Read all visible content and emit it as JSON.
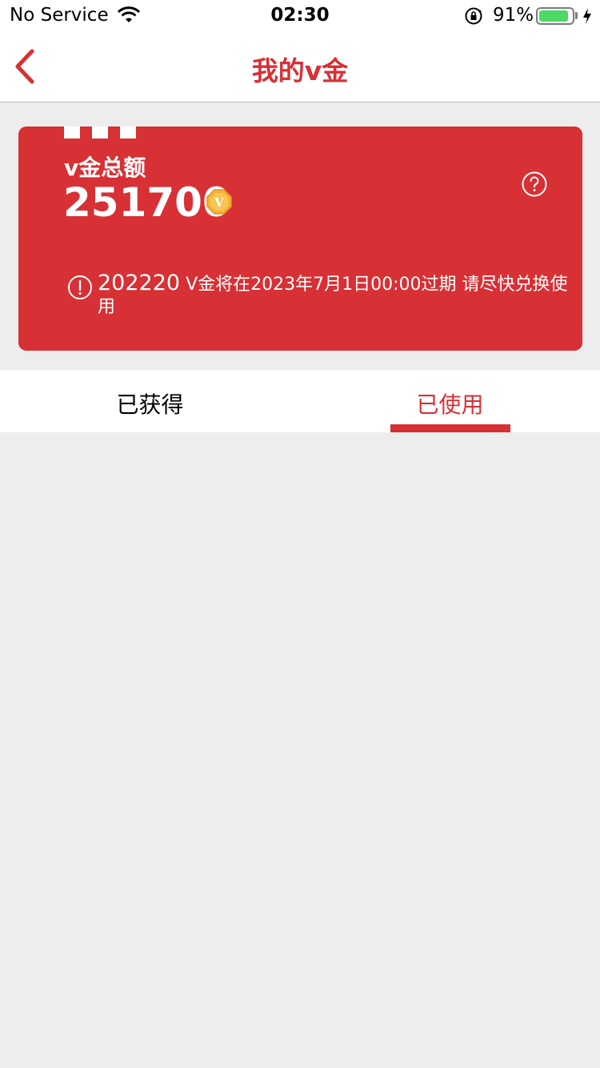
{
  "status_bar": {
    "carrier": "No Service",
    "time": "02:30",
    "battery_percent": "91%",
    "battery_level": 0.91,
    "icons": [
      "wifi-icon",
      "orientation-lock-icon",
      "battery-icon",
      "charging-icon"
    ]
  },
  "nav": {
    "title": "我的v金",
    "back_icon": "chevron-left-icon"
  },
  "card": {
    "label": "v金总额",
    "amount": "251700",
    "coin_icon": "v-coin-icon",
    "help_icon": "question-circle-icon",
    "notice_icon": "exclamation-circle-icon",
    "notice_amount": "202220",
    "notice_text": " V金将在2023年7月1日00:00过期 请尽快兑换使用"
  },
  "tabs": [
    {
      "label": "已获得",
      "active": false
    },
    {
      "label": "已使用",
      "active": true
    }
  ],
  "colors": {
    "accent": "#d73035",
    "background": "#ededed",
    "battery": "#4cd964",
    "coin": "#f5b335"
  }
}
